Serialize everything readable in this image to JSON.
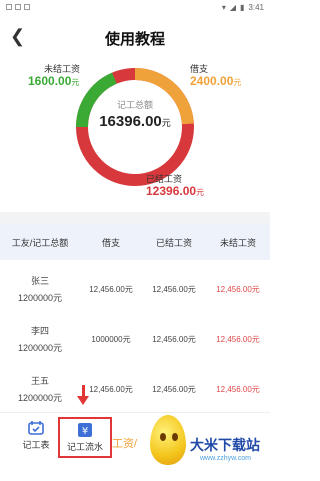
{
  "status": {
    "time": "3:41",
    "signal_icon": "signal-icon",
    "battery_icon": "battery-icon"
  },
  "header": {
    "title": "使用教程",
    "back_icon": "chevron-left-icon"
  },
  "summary": {
    "center_label": "记工总额",
    "center_value": "16396.00",
    "center_unit": "元",
    "unpaid": {
      "label": "未结工资",
      "value": "1600.00",
      "unit": "元",
      "color": "#3aaa35"
    },
    "borrow": {
      "label": "借支",
      "value": "2400.00",
      "unit": "元",
      "color": "#f0a23a"
    },
    "paid": {
      "label": "已结工资",
      "value": "12396.00",
      "unit": "元",
      "color": "#d7383c"
    }
  },
  "table": {
    "headers": [
      "工友/记工总额",
      "借支",
      "已结工资",
      "未结工资"
    ],
    "rows": [
      {
        "name": "张三",
        "total": "1200000元",
        "borrow": "12,456.00元",
        "paid": "12,456.00元",
        "unpaid": "12,456.00元"
      },
      {
        "name": "李四",
        "total": "1200000元",
        "borrow": "1000000元",
        "paid": "12,456.00元",
        "unpaid": "12,456.00元"
      },
      {
        "name": "王五",
        "total": "1200000元",
        "borrow": "12,456.00元",
        "paid": "12,456.00元",
        "unpaid": "12,456.00元"
      }
    ]
  },
  "bottom": {
    "tab1_label": "记工表",
    "tab2_label": "记工流水",
    "mid_label": "工资/",
    "watermark_name": "大米下载站",
    "watermark_url": "www.zzhyw.com"
  }
}
